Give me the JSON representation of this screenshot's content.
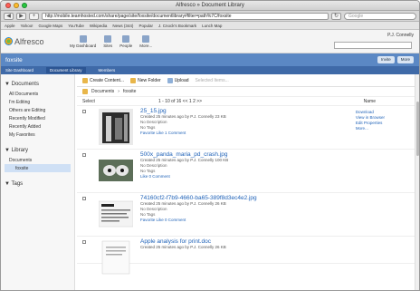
{
  "window": {
    "title": "Alfresco » Document Library"
  },
  "nav": {
    "url": "http://mobile.teamhosted.com/share/page/site/foxsite/documentlibrary#filter=path%7C/foxsite",
    "search_placeholder": "Google"
  },
  "bookmarks": [
    "Apple",
    "Yahoo!",
    "Google Maps",
    "YouTube",
    "Wikipedia",
    "News (344)",
    "Popular",
    "J. Cnock's Bookmark",
    "Lunch Map"
  ],
  "header": {
    "brand": "Alfresco",
    "nav": [
      "My Dashboard",
      "Sites",
      "People",
      "More..."
    ],
    "user": "P.J. Connelly",
    "search_placeholder": ""
  },
  "site": {
    "title": "foxsite",
    "buttons": [
      "Invite",
      "More"
    ],
    "tabs": [
      "Site Dashboard",
      "Document Library",
      "Members"
    ]
  },
  "sidebar": {
    "documents_head": "Documents",
    "documents_items": [
      "All Documents",
      "I'm Editing",
      "Others are Editing",
      "Recently Modified",
      "Recently Added",
      "My Favorites"
    ],
    "library_head": "Library",
    "library_items": [
      "Documents",
      "foxsite"
    ],
    "tags_head": "Tags"
  },
  "toolbar": {
    "create": "Create Content...",
    "new_folder": "New Folder",
    "upload": "Upload",
    "selected": "Selected Items..."
  },
  "breadcrumb": [
    "Documents",
    "foxsite"
  ],
  "listbar": {
    "select": "Select",
    "pager": "1 - 10 of 16  <<  1  2  >>",
    "sort": "Name"
  },
  "files": [
    {
      "name": "25_15.jpg",
      "meta": "Created 25 minutes ago by P.J. Connelly   23 KB",
      "desc": "No Description",
      "tags": "No Tags",
      "social": "Favorite    Like 1    Comment",
      "actions": [
        "Download",
        "View in Browser",
        "Edit Properties",
        "More..."
      ]
    },
    {
      "name": "500x_panda_maria_pd_crash.jpg",
      "meta": "Created 25 minutes ago by P.J. Connelly   100 KB",
      "desc": "No Description",
      "tags": "No Tags",
      "social": "Like 0    Comment"
    },
    {
      "name": "74160cf2-f7b9-4660-ba65-389f8d3ec4e2.jpg",
      "meta": "Created 25 minutes ago by P.J. Connelly   26 KB",
      "desc": "No Description",
      "tags": "No Tags",
      "social": "Favorite    Like 0    Comment"
    },
    {
      "name": "Apple analysis for print.doc",
      "meta": "Created 25 minutes ago by P.J. Connelly   26 KB",
      "desc": "",
      "tags": "",
      "social": ""
    }
  ]
}
